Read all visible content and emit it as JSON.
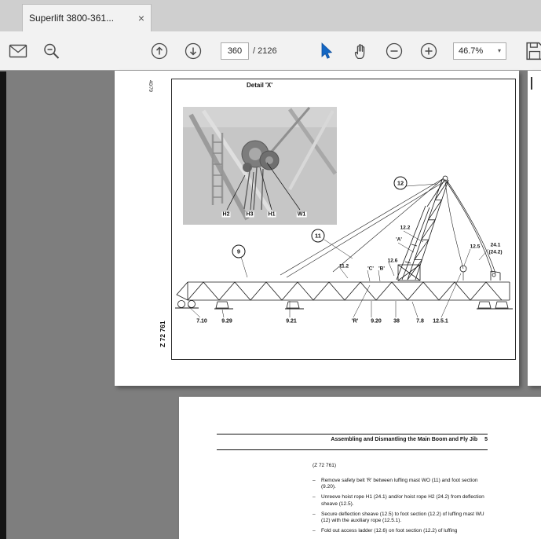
{
  "window": {
    "tab_title": "Superlift 3800-361...",
    "tab_close": "×"
  },
  "toolbar": {
    "page_current": "360",
    "page_total": "/ 2126",
    "zoom_level": "46.7%",
    "caret": "▾"
  },
  "colors": {
    "pointer_blue": "#1467c4",
    "icon_gray": "#4a4a4a",
    "viewer_background": "#7e7e7e"
  },
  "page1": {
    "corner_index": "40/79",
    "drawing_code": "Z 72 761",
    "detail_title": "Detail 'X'",
    "photo_labels": [
      "H2",
      "H3",
      "H1",
      "W1"
    ],
    "callouts": {
      "c12": "12",
      "c11": "11",
      "c9": "9",
      "l122": "12.2",
      "lA": "'A'",
      "l125": "12.5",
      "l241": "24.1",
      "l242": "(24.2)",
      "l112": "11.2",
      "lC": "'C'",
      "lB": "'B'",
      "l126": "12.6"
    },
    "bottom_labels": [
      "7.10",
      "9.29",
      "9.21",
      "'R'",
      "9.20",
      "38",
      "7.8",
      "12.5.1"
    ]
  },
  "page2": {
    "header_title": "Assembling and Dismantling the Main Boom and Fly Jib",
    "header_page": "5",
    "figure_ref": "(Z 72 761)",
    "bullet": "–",
    "items": [
      "Remove safety belt 'R' between luffing mast WO (11) and foot section (9.20).",
      "Unreeve hoist rope H1 (24.1) and/or hoist rope H2 (24.2) from deflection sheave (12.5).",
      "Secure deflection sheave (12.5) to foot section (12.2) of luffing mast WU (12) with the auxiliary rope (12.5.1).",
      "Fold out access ladder (12.6) on foot section (12.2) of luffing"
    ]
  }
}
